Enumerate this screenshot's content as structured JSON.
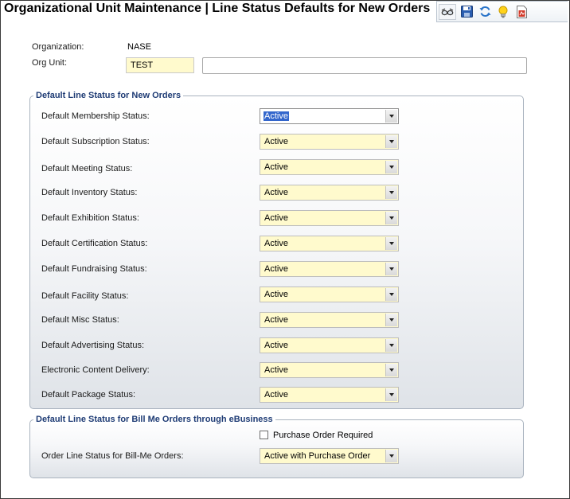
{
  "page_title": "Organizational Unit Maintenance | Line Status Defaults for New Orders",
  "toolbar": {
    "icons": [
      "glasses-icon",
      "save-icon",
      "refresh-icon",
      "lightbulb-icon",
      "report-icon"
    ]
  },
  "header": {
    "organization_label": "Organization:",
    "organization_value": "NASE",
    "org_unit_label": "Org Unit:",
    "org_unit_value": "TEST",
    "org_unit_description": ""
  },
  "new_orders": {
    "legend": "Default Line Status for New Orders",
    "rows": [
      {
        "label": "Default Membership Status:",
        "value": "Active"
      },
      {
        "label": "Default Subscription Status:",
        "value": "Active"
      },
      {
        "label": "Default Meeting Status:",
        "value": "Active"
      },
      {
        "label": "Default Inventory Status:",
        "value": "Active"
      },
      {
        "label": "Default Exhibition Status:",
        "value": "Active"
      },
      {
        "label": "Default Certification Status:",
        "value": "Active"
      },
      {
        "label": "Default Fundraising Status:",
        "value": "Active"
      },
      {
        "label": "Default Facility Status:",
        "value": "Active"
      },
      {
        "label": "Default Misc Status:",
        "value": "Active"
      },
      {
        "label": "Default Advertising Status:",
        "value": "Active"
      },
      {
        "label": "Electronic Content Delivery:",
        "value": "Active"
      },
      {
        "label": "Default Package Status:",
        "value": "Active"
      }
    ]
  },
  "bill_me": {
    "legend": "Default Line Status for Bill Me Orders through eBusiness",
    "po_required_label": "Purchase Order Required",
    "po_required_checked": false,
    "order_line_label": "Order Line Status for Bill-Me Orders:",
    "order_line_value": "Active with Purchase Order"
  },
  "colors": {
    "legend_text": "#1f3c75",
    "required_field": "#fffacd",
    "selection_highlight": "#3366cc"
  }
}
